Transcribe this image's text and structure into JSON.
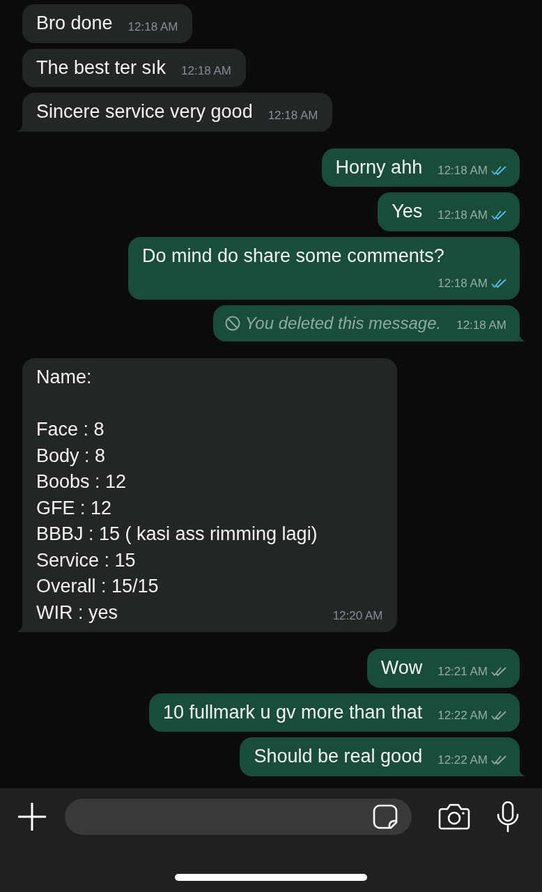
{
  "messages": [
    {
      "outgoing": false,
      "kind": "text",
      "text": "Bro done",
      "time": "12:18 AM"
    },
    {
      "outgoing": false,
      "kind": "text",
      "text": "The best ter sık",
      "time": "12:18 AM"
    },
    {
      "outgoing": false,
      "kind": "text",
      "text": "Sincere service very good",
      "time": "12:18 AM"
    },
    {
      "outgoing": true,
      "kind": "text",
      "text": "Horny ahh",
      "time": "12:18 AM",
      "read": true
    },
    {
      "outgoing": true,
      "kind": "text",
      "text": "Yes",
      "time": "12:18 AM",
      "read": true
    },
    {
      "outgoing": true,
      "kind": "text",
      "text": "Do mind do share some comments?",
      "time": "12:18 AM",
      "read": true
    },
    {
      "outgoing": true,
      "kind": "deleted",
      "text": "You deleted this message.",
      "time": "12:18 AM"
    },
    {
      "outgoing": false,
      "kind": "text",
      "text": "Name:\n\nFace : 8\nBody : 8\nBoobs : 12\nGFE : 12\nBBBJ : 15 ( kasi ass rimming lagi)\nService : 15\nOverall : 15/15\nWIR : yes",
      "time": "12:20 AM"
    },
    {
      "outgoing": true,
      "kind": "text",
      "text": "Wow",
      "time": "12:21 AM",
      "read": false
    },
    {
      "outgoing": true,
      "kind": "text",
      "text": "10 fullmark u gv more than that",
      "time": "12:22 AM",
      "read": false
    },
    {
      "outgoing": true,
      "kind": "text",
      "text": "Should be real good",
      "time": "12:22 AM",
      "read": false
    }
  ]
}
